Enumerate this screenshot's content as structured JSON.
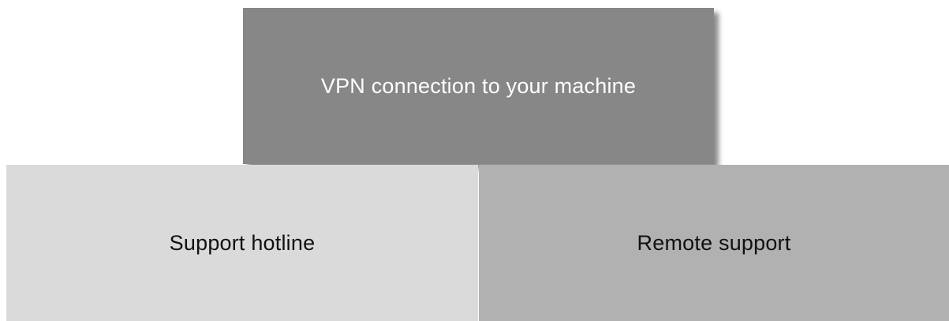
{
  "diagram": {
    "blocks": [
      {
        "label": "VPN connection to your machine",
        "fill": "#878787",
        "text_color": "#ffffff"
      },
      {
        "label": "Support hotline",
        "fill": "#dadada",
        "text_color": "#111111"
      },
      {
        "label": "Remote support",
        "fill": "#b1b1b1",
        "text_color": "#111111"
      }
    ]
  }
}
